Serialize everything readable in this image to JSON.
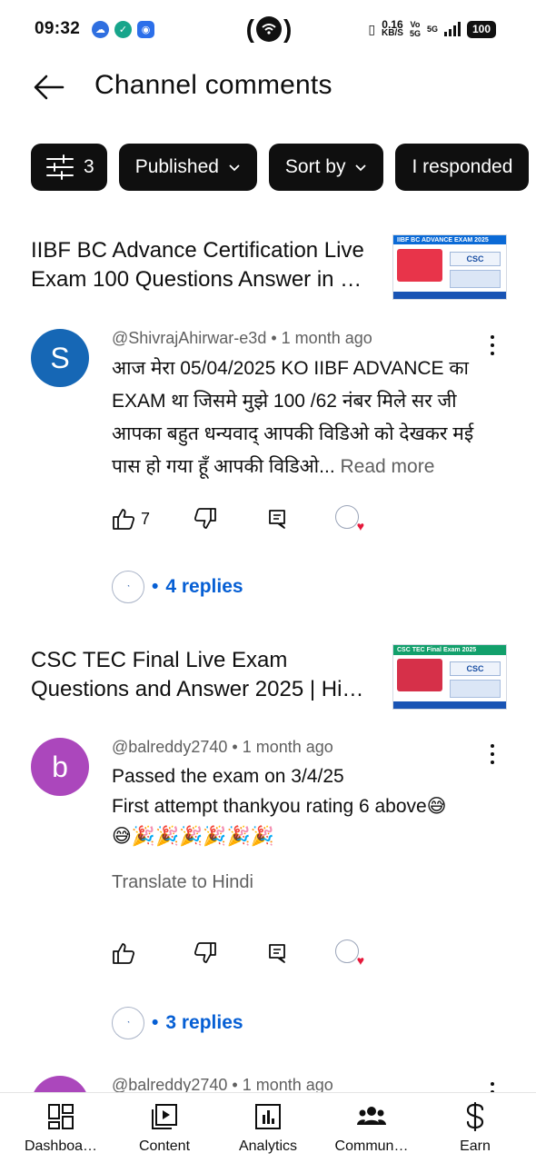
{
  "status_bar": {
    "time": "09:32",
    "net_speed_value": "0.16",
    "net_speed_unit": "KB/S",
    "volte_top": "Vo",
    "volte_bottom": "5G",
    "network": "5G",
    "battery": "100"
  },
  "header": {
    "title": "Channel comments"
  },
  "chips": {
    "filter_count": "3",
    "published": "Published",
    "sort_by": "Sort by",
    "responded": "I responded"
  },
  "videos": [
    {
      "title": "IIBF BC Advance Certification Live Exam 100 Questions Answer in …",
      "thumb_caption": "IIBF BC ADVANCE EXAM 2025",
      "thumb_logo": "CSC",
      "comment": {
        "avatar_letter": "S",
        "avatar_color": "#1667b5",
        "author": "@ShivrajAhirwar-e3d",
        "time": "1 month ago",
        "text": "आज मेरा 05/04/2025 KO IIBF ADVANCE का EXAM था जिसमे मुझे 100 /62 नंबर मिले सर जी आपका बहुत धन्यवाद् आपकी विडिओ को देखकर मई पास हो गया हूँ आपकी विडिओ...",
        "read_more": "Read more",
        "likes": "7",
        "replies": "4 replies"
      }
    },
    {
      "title": "CSC TEC Final Live Exam Questions and Answer 2025 | Hi…",
      "thumb_caption": "CSC TEC Final Exam 2025",
      "thumb_logo": "CSC",
      "comment": {
        "avatar_letter": "b",
        "avatar_color": "#ab47bc",
        "author": "@balreddy2740",
        "time": "1 month ago",
        "line1": "Passed the exam on 3/4/25",
        "line2": "First attempt thankyou rating 6 above😅",
        "line3": "😅🎉🎉🎉🎉🎉🎉",
        "translate": "Translate to Hindi",
        "likes": "",
        "replies": "3 replies"
      }
    },
    {
      "comment": {
        "avatar_letter": "b",
        "avatar_color": "#ab47bc",
        "author": "@balreddy2740",
        "time": "1 month ago"
      }
    }
  ],
  "bottom_nav": [
    {
      "label": "Dashboa…",
      "icon": "dashboard-icon"
    },
    {
      "label": "Content",
      "icon": "content-icon"
    },
    {
      "label": "Analytics",
      "icon": "analytics-icon"
    },
    {
      "label": "Commun…",
      "icon": "community-icon"
    },
    {
      "label": "Earn",
      "icon": "dollar-icon"
    }
  ]
}
